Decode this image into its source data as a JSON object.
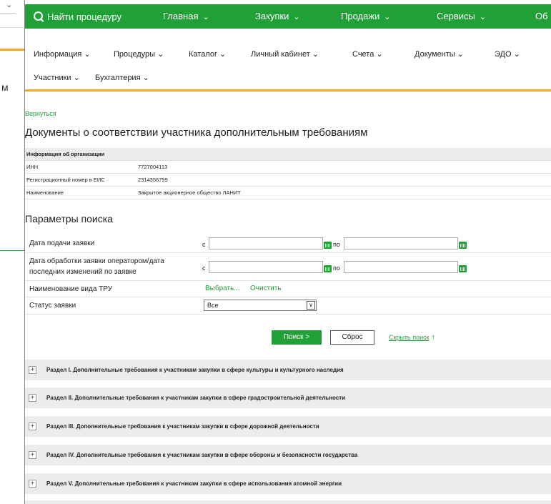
{
  "background": {
    "select_chevron": "⌄",
    "partial_char": "м"
  },
  "topbar": {
    "search_label": "Найти процедуру",
    "items": [
      {
        "label": "Главная",
        "chevron": "⌄"
      },
      {
        "label": "Закупки",
        "chevron": "⌄"
      },
      {
        "label": "Продажи",
        "chevron": "⌄"
      },
      {
        "label": "Сервисы",
        "chevron": "⌄"
      },
      {
        "label": "Об"
      }
    ]
  },
  "menu": {
    "row1": [
      "Информация ⌄",
      "Процедуры ⌄",
      "Каталог ⌄",
      "Личный кабинет ⌄",
      "Счета ⌄",
      "Документы ⌄",
      "ЭДО ⌄"
    ],
    "row2": [
      "Участники ⌄",
      "Бухгалтерия ⌄"
    ]
  },
  "back_link": "Вернуться",
  "page_title": "Документы о соответствии участника дополнительным требованиям",
  "org": {
    "header": "Информация об организации",
    "rows": [
      {
        "label": "ИНН",
        "value": "7727004113"
      },
      {
        "label": "Регистрационный номер в ЕИС",
        "value": "2314356799"
      },
      {
        "label": "Наименование",
        "value": "Закрытое акционерное общество ЛАНИТ"
      }
    ]
  },
  "params": {
    "title": "Параметры поиска",
    "submission_date": "Дата подачи заявки",
    "processing_date": "Дата обработки заявки оператором/дата последних изменений по заявке",
    "from": "с",
    "to": "по",
    "tru_label": "Наименование вида ТРУ",
    "choose": "Выбрать...",
    "clear": "Очистить",
    "status_label": "Статус заявки",
    "status_value": "Все"
  },
  "buttons": {
    "search": "Поиск  >",
    "reset": "Сброс",
    "hide_search": "Скрыть поиск",
    "hide_arrow": "↑"
  },
  "sections": [
    "Раздел I. Дополнительные требования к участникам закупки в сфере культуры и культурного наследия",
    "Раздел II. Дополнительные требования к участникам закупки в сфере градостроительной деятельности",
    "Раздел III. Дополнительные требования к участникам закупки в сфере дорожной деятельности",
    "Раздел IV. Дополнительные требования к участникам закупки в сфере обороны и безопасности государства",
    "Раздел V. Дополнительные требования к участникам закупки в сфере использования атомной энергии"
  ],
  "colors": {
    "brand_green": "#21a038",
    "accent_orange": "#f5a623"
  }
}
